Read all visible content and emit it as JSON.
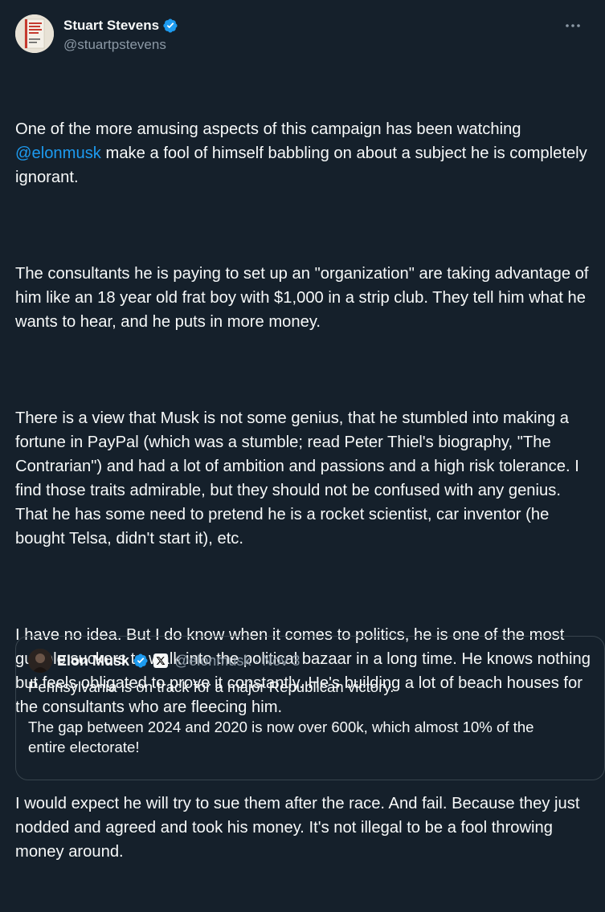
{
  "author": {
    "display_name": "Stuart Stevens",
    "handle": "@stuartpstevens",
    "avatar_book_text": "THE CONSPIRACY TO END AMERICA"
  },
  "more_icon": "more-horizontal-icon",
  "tweet": {
    "p1_before": "One of the more amusing aspects of this campaign has been watching ",
    "p1_mention": "@elonmusk",
    "p1_after": " make a fool of himself babbling on about a subject he is completely ignorant.",
    "p2": "The consultants he is paying to set up an \"organization\" are taking advantage of him like an 18 year old frat boy with $1,000 in a strip club. They tell him what he wants to hear, and he puts in more money.",
    "p3": "There is a view that Musk is not some genius, that he stumbled into making a fortune in PayPal (which was a stumble; read Peter Thiel's biography, \"The Contrarian\") and had a lot of ambition and passions and a high risk tolerance. I find those traits admirable, but they should not be confused with any genius. That he has some need to pretend he is a rocket scientist, car inventor (he bought Telsa, didn't start it), etc.",
    "p4": "I have no idea. But I do know when it comes to politics, he is one of the most gullible suckers to walk into the political bazaar in a long time. He knows nothing but feels obligated to prove it constantly. He's building a lot of beach houses for the consultants who are fleecing him.",
    "p5": "I would expect he will try to sue them after the race. And fail. Because they just nodded and agreed and took his money. It's not illegal to be a fool throwing money around."
  },
  "quote": {
    "display_name": "Elon Musk",
    "handle": "@elonmusk",
    "separator": "·",
    "date": "Nov 3",
    "p1": "Pennsylvania is on track for a major Republican victory.",
    "p2": "The gap between 2024 and 2020 is now over 600k, which almost 10% of the entire electorate!"
  },
  "colors": {
    "background": "#15202b",
    "text": "#f7f9f9",
    "secondary": "#8b98a5",
    "accent": "#1d9bf0",
    "border": "#38444d"
  }
}
